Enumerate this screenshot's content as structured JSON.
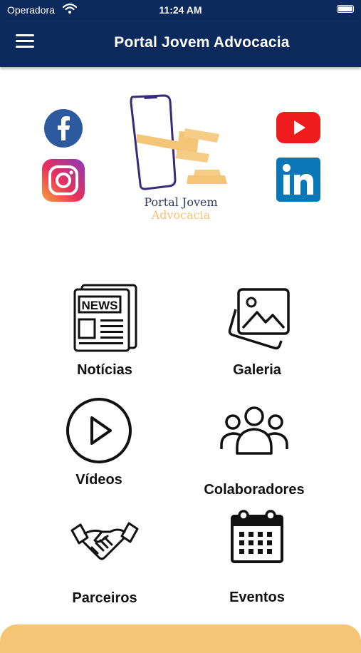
{
  "status_bar": {
    "carrier": "Operadora",
    "time": "11:24 AM"
  },
  "nav": {
    "title": "Portal Jovem Advocacia"
  },
  "logo": {
    "line1": "Portal Jovem",
    "line2": "Advocacia"
  },
  "social": [
    "facebook-icon",
    "instagram-icon",
    "youtube-icon",
    "linkedin-icon"
  ],
  "menu": {
    "noticias": "Notícias",
    "galeria": "Galeria",
    "videos": "Vídeos",
    "colaboradores": "Colaboradores",
    "parceiros": "Parceiros",
    "eventos": "Eventos"
  },
  "colors": {
    "primary": "#0b2a5b",
    "accent": "#f3c574"
  }
}
